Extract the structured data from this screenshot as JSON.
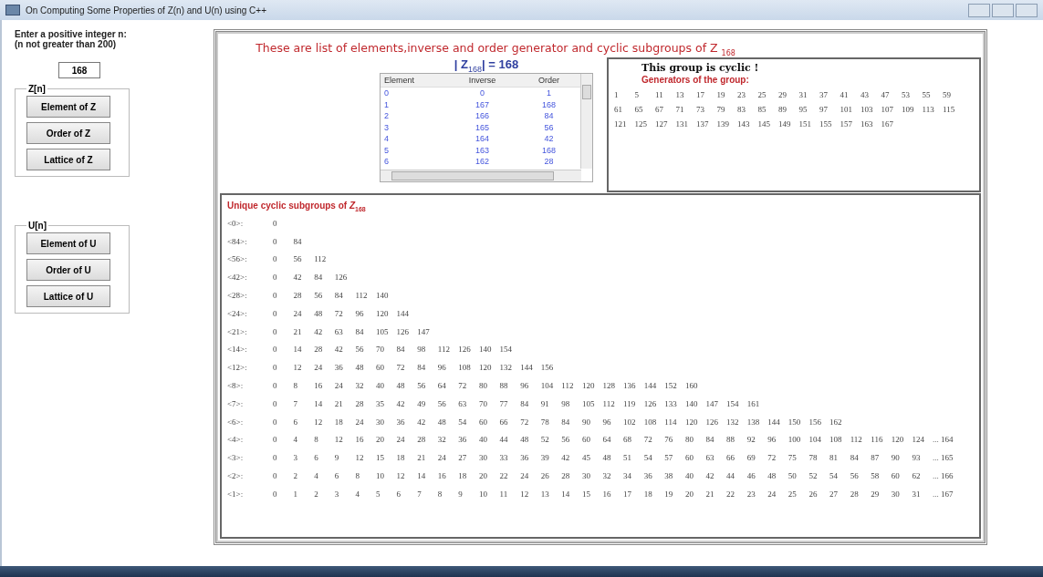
{
  "window": {
    "title": "On Computing Some Properties of Z(n) and U(n) using C++"
  },
  "input_panel": {
    "prompt": "Enter a positive integer n:",
    "hint": "(n not greater than 200)",
    "value": "168"
  },
  "groups": [
    {
      "title": "Z[n]",
      "buttons": [
        "Element of Z",
        "Order of Z",
        "Lattice of Z"
      ]
    },
    {
      "title": "U[n]",
      "buttons": [
        "Element of U",
        "Order of U",
        "Lattice of U"
      ]
    }
  ],
  "heading": "These are list of elements,inverse and order generator and cyclic subgroups of Z $_{168}$",
  "order_line": "| Z$_{168}$| = 168",
  "table": {
    "columns": [
      "Element",
      "Inverse",
      "Order"
    ],
    "rows": [
      [
        "0",
        "0",
        "1"
      ],
      [
        "1",
        "167",
        "168"
      ],
      [
        "2",
        "166",
        "84"
      ],
      [
        "3",
        "165",
        "56"
      ],
      [
        "4",
        "164",
        "42"
      ],
      [
        "5",
        "163",
        "168"
      ],
      [
        "6",
        "162",
        "28"
      ]
    ]
  },
  "cyclic_panel": {
    "status": "This group is cyclic !",
    "generators_title": "Generators of the group:",
    "generators": [
      "1",
      "5",
      "11",
      "13",
      "17",
      "19",
      "23",
      "25",
      "29",
      "31",
      "37",
      "41",
      "43",
      "47",
      "53",
      "55",
      "59",
      "61",
      "65",
      "67",
      "71",
      "73",
      "79",
      "83",
      "85",
      "89",
      "95",
      "97",
      "101",
      "103",
      "107",
      "109",
      "113",
      "115",
      "121",
      "125",
      "127",
      "131",
      "137",
      "139",
      "143",
      "145",
      "149",
      "151",
      "155",
      "157",
      "163",
      "167"
    ]
  },
  "subgroups": {
    "title": "Unique cyclic subgroups of *Z*$_{168}$",
    "rows": [
      {
        "label": "<0>:",
        "values": [
          "0"
        ]
      },
      {
        "label": "<84>:",
        "values": [
          "0",
          "84"
        ]
      },
      {
        "label": "<56>:",
        "values": [
          "0",
          "56",
          "112"
        ]
      },
      {
        "label": "<42>:",
        "values": [
          "0",
          "42",
          "84",
          "126"
        ]
      },
      {
        "label": "<28>:",
        "values": [
          "0",
          "28",
          "56",
          "84",
          "112",
          "140"
        ]
      },
      {
        "label": "<24>:",
        "values": [
          "0",
          "24",
          "48",
          "72",
          "96",
          "120",
          "144"
        ]
      },
      {
        "label": "<21>:",
        "values": [
          "0",
          "21",
          "42",
          "63",
          "84",
          "105",
          "126",
          "147"
        ]
      },
      {
        "label": "<14>:",
        "values": [
          "0",
          "14",
          "28",
          "42",
          "56",
          "70",
          "84",
          "98",
          "112",
          "126",
          "140",
          "154"
        ]
      },
      {
        "label": "<12>:",
        "values": [
          "0",
          "12",
          "24",
          "36",
          "48",
          "60",
          "72",
          "84",
          "96",
          "108",
          "120",
          "132",
          "144",
          "156"
        ]
      },
      {
        "label": "<8>:",
        "values": [
          "0",
          "8",
          "16",
          "24",
          "32",
          "40",
          "48",
          "56",
          "64",
          "72",
          "80",
          "88",
          "96",
          "104",
          "112",
          "120",
          "128",
          "136",
          "144",
          "152",
          "160"
        ]
      },
      {
        "label": "<7>:",
        "values": [
          "0",
          "7",
          "14",
          "21",
          "28",
          "35",
          "42",
          "49",
          "56",
          "63",
          "70",
          "77",
          "84",
          "91",
          "98",
          "105",
          "112",
          "119",
          "126",
          "133",
          "140",
          "147",
          "154",
          "161"
        ]
      },
      {
        "label": "<6>:",
        "values": [
          "0",
          "6",
          "12",
          "18",
          "24",
          "30",
          "36",
          "42",
          "48",
          "54",
          "60",
          "66",
          "72",
          "78",
          "84",
          "90",
          "96",
          "102",
          "108",
          "114",
          "120",
          "126",
          "132",
          "138",
          "144",
          "150",
          "156",
          "162"
        ]
      },
      {
        "label": "<4>:",
        "values": [
          "0",
          "4",
          "8",
          "12",
          "16",
          "20",
          "24",
          "28",
          "32",
          "36",
          "40",
          "44",
          "48",
          "52",
          "56",
          "60",
          "64",
          "68",
          "72",
          "76",
          "80",
          "84",
          "88",
          "92",
          "96",
          "100",
          "104",
          "108",
          "112",
          "116",
          "120",
          "124",
          "... 164"
        ]
      },
      {
        "label": "<3>:",
        "values": [
          "0",
          "3",
          "6",
          "9",
          "12",
          "15",
          "18",
          "21",
          "24",
          "27",
          "30",
          "33",
          "36",
          "39",
          "42",
          "45",
          "48",
          "51",
          "54",
          "57",
          "60",
          "63",
          "66",
          "69",
          "72",
          "75",
          "78",
          "81",
          "84",
          "87",
          "90",
          "93",
          "... 165"
        ]
      },
      {
        "label": "<2>:",
        "values": [
          "0",
          "2",
          "4",
          "6",
          "8",
          "10",
          "12",
          "14",
          "16",
          "18",
          "20",
          "22",
          "24",
          "26",
          "28",
          "30",
          "32",
          "34",
          "36",
          "38",
          "40",
          "42",
          "44",
          "46",
          "48",
          "50",
          "52",
          "54",
          "56",
          "58",
          "60",
          "62",
          "... 166"
        ]
      },
      {
        "label": "<1>:",
        "values": [
          "0",
          "1",
          "2",
          "3",
          "4",
          "5",
          "6",
          "7",
          "8",
          "9",
          "10",
          "11",
          "12",
          "13",
          "14",
          "15",
          "16",
          "17",
          "18",
          "19",
          "20",
          "21",
          "22",
          "23",
          "24",
          "25",
          "26",
          "27",
          "28",
          "29",
          "30",
          "31",
          "... 167"
        ]
      }
    ]
  }
}
